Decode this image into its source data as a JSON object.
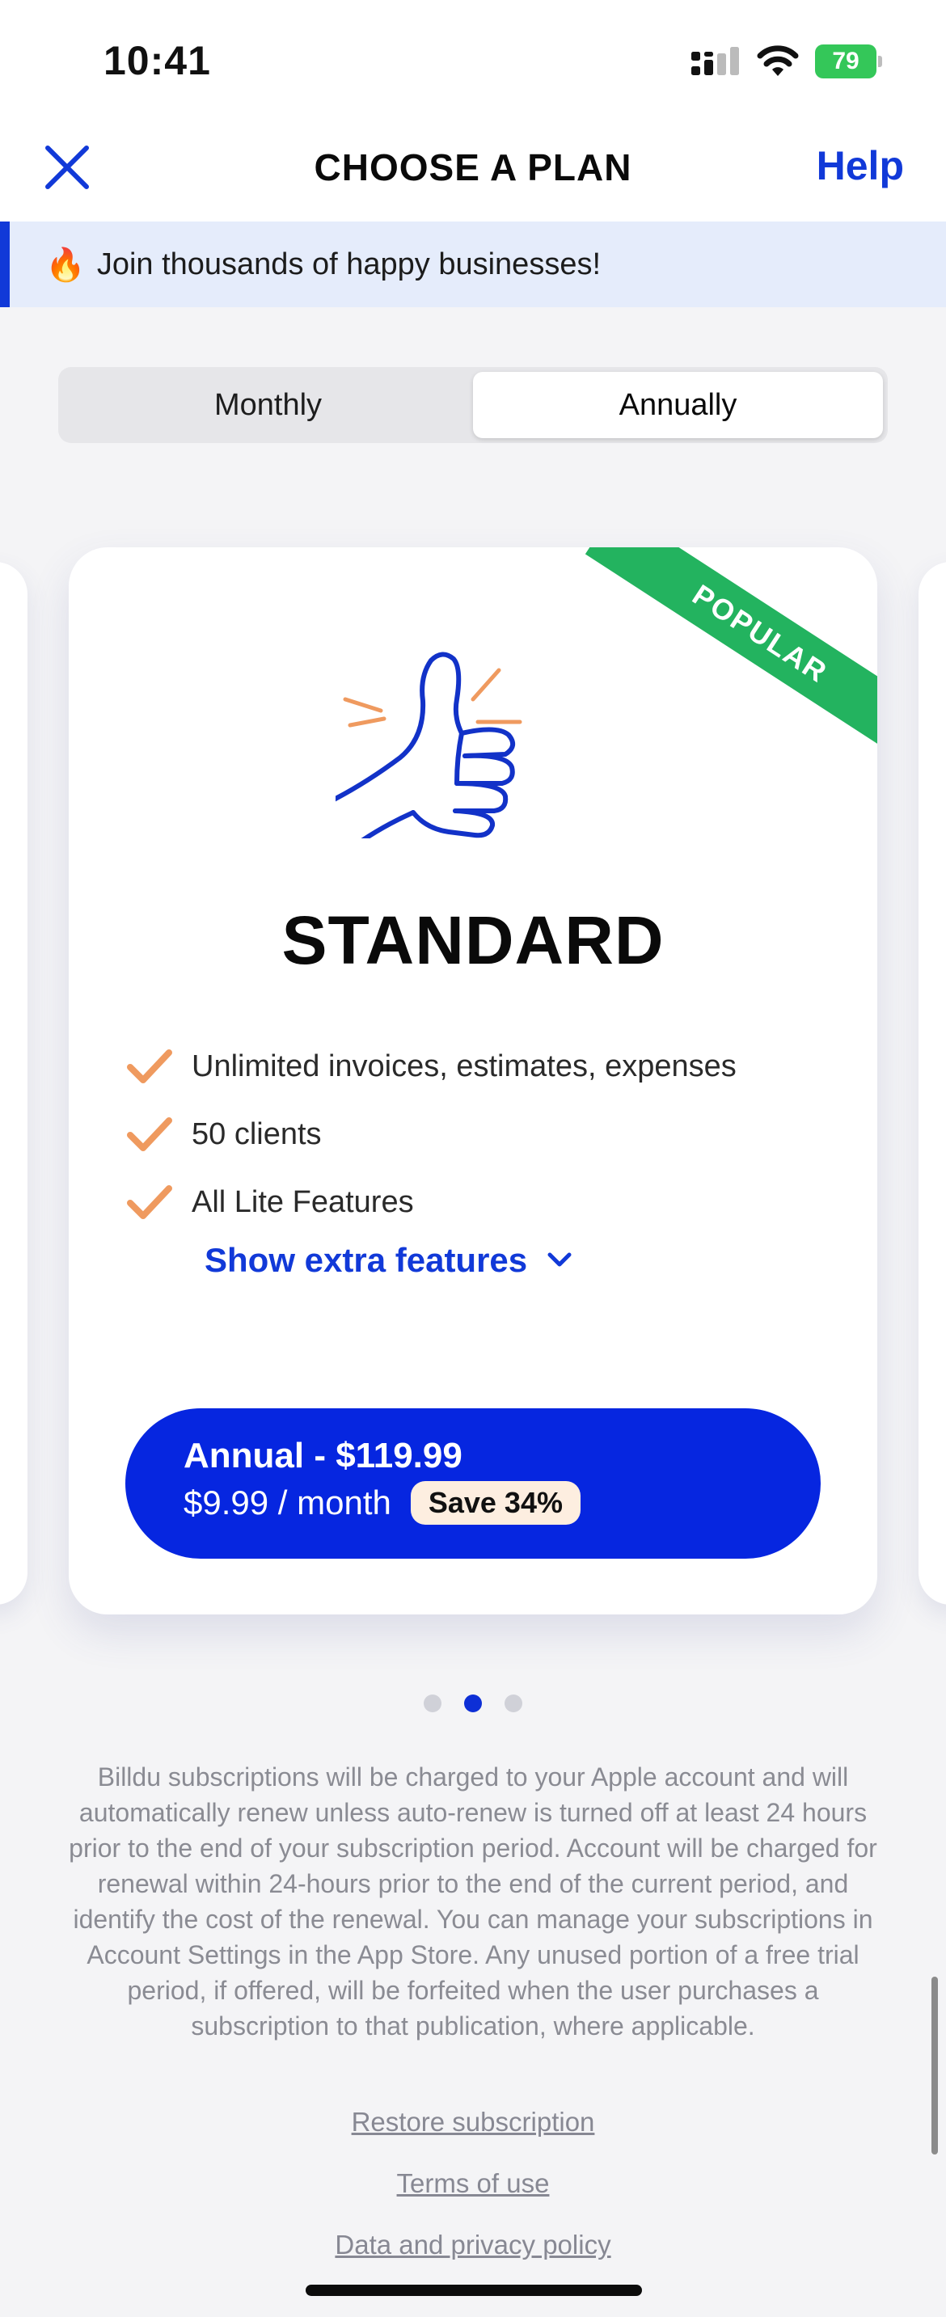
{
  "status_bar": {
    "time": "10:41",
    "battery": "79"
  },
  "header": {
    "title": "CHOOSE A PLAN",
    "help_label": "Help"
  },
  "banner": {
    "emoji": "🔥",
    "text": "Join thousands of happy businesses!"
  },
  "billing_toggle": {
    "options": [
      "Monthly",
      "Annually"
    ],
    "selected": "Annually"
  },
  "plan": {
    "badge": "POPULAR",
    "name": "STANDARD",
    "features": [
      "Unlimited invoices, estimates, expenses",
      "50 clients",
      "All Lite Features"
    ],
    "show_extra_label": "Show extra features",
    "cta": {
      "title": "Annual - $119.99",
      "per_month": "$9.99 / month",
      "save": "Save 34%"
    }
  },
  "pagination": {
    "total": 3,
    "active_index": 1
  },
  "legal_text": "Billdu subscriptions will be charged to your Apple account and will automatically renew unless auto-renew is turned off at least 24 hours prior to the end of your subscription period. Account will be charged for renewal within 24-hours prior to the end of the current period, and identify the cost of the renewal. You can manage your subscriptions in Account Settings in the App Store. Any unused portion of a free trial period, if offered, will be forfeited when the user purchases a subscription to that publication, where applicable.",
  "links": {
    "restore": "Restore subscription",
    "terms": "Terms of use",
    "privacy": "Data and privacy policy"
  },
  "colors": {
    "accent": "#1139d8",
    "cta": "#0626e0",
    "ribbon": "#23b35f",
    "check": "#ef9a5f",
    "banner_bg": "#e5ecfb"
  }
}
